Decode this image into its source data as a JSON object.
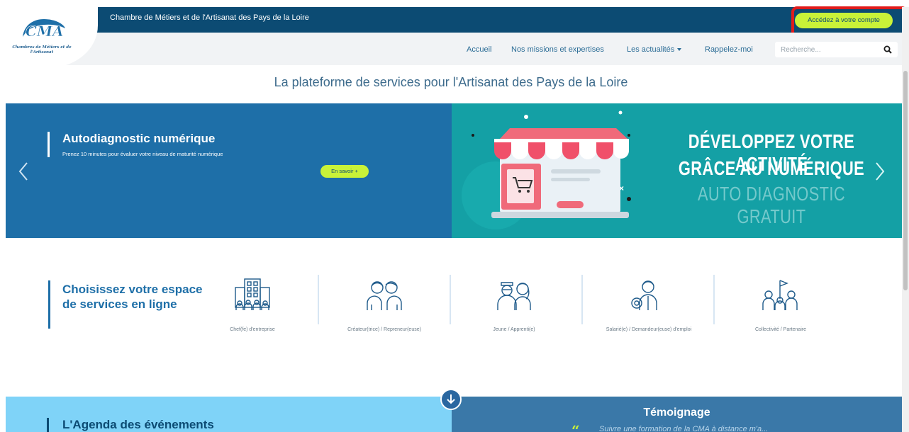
{
  "header": {
    "org_name": "Chambre de Métiers et de l'Artisanat des Pays de la Loire",
    "account_button": "Accédez à votre compte",
    "logo_text": "Chambres de Métiers et de l'Artisanat",
    "highlight_color": "#e01b1b"
  },
  "nav": {
    "items": [
      "Accueil",
      "Nos missions et expertises",
      "Les actualités",
      "Rappelez-moi"
    ],
    "search_placeholder": "Recherche..."
  },
  "tagline": "La plateforme de services pour l'Artisanat des Pays de la Loire",
  "banner": {
    "title": "Autodiagnostic numérique",
    "subtitle": "Prenez 10 minutes pour évaluer votre niveau de maturité numérique",
    "button": "En savoir +",
    "promo_line1": "DÉVELOPPEZ VOTRE ACTIVITÉ",
    "promo_line2": "GRÂCE AU NUMÉRIQUE",
    "promo_line3": "AUTO DIAGNOSTIC GRATUIT"
  },
  "services": {
    "title": "Choisissez votre espace de services en ligne",
    "items": [
      {
        "label": "Chef(fe) d'entreprise",
        "icon": "building-icon"
      },
      {
        "label": "Créateur(trice) / Repreneur(euse)",
        "icon": "two-people-icon"
      },
      {
        "label": "Jeune / Apprenti(e)",
        "icon": "young-people-icon"
      },
      {
        "label": "Salarié(e) / Demandeur(euse) d'emploi",
        "icon": "employee-icon"
      },
      {
        "label": "Collectivité / Partenaire",
        "icon": "community-flag-icon"
      }
    ]
  },
  "bottom": {
    "agenda_title": "L'Agenda des événements",
    "temoignage_title": "Témoignage",
    "temoignage_quote": "Suivre une formation de la CMA à distance m'a..."
  },
  "colors": {
    "navy": "#0c4b73",
    "lime": "#c9f238",
    "banner_blue": "#1e6fa8",
    "banner_teal": "#14a0a5"
  }
}
